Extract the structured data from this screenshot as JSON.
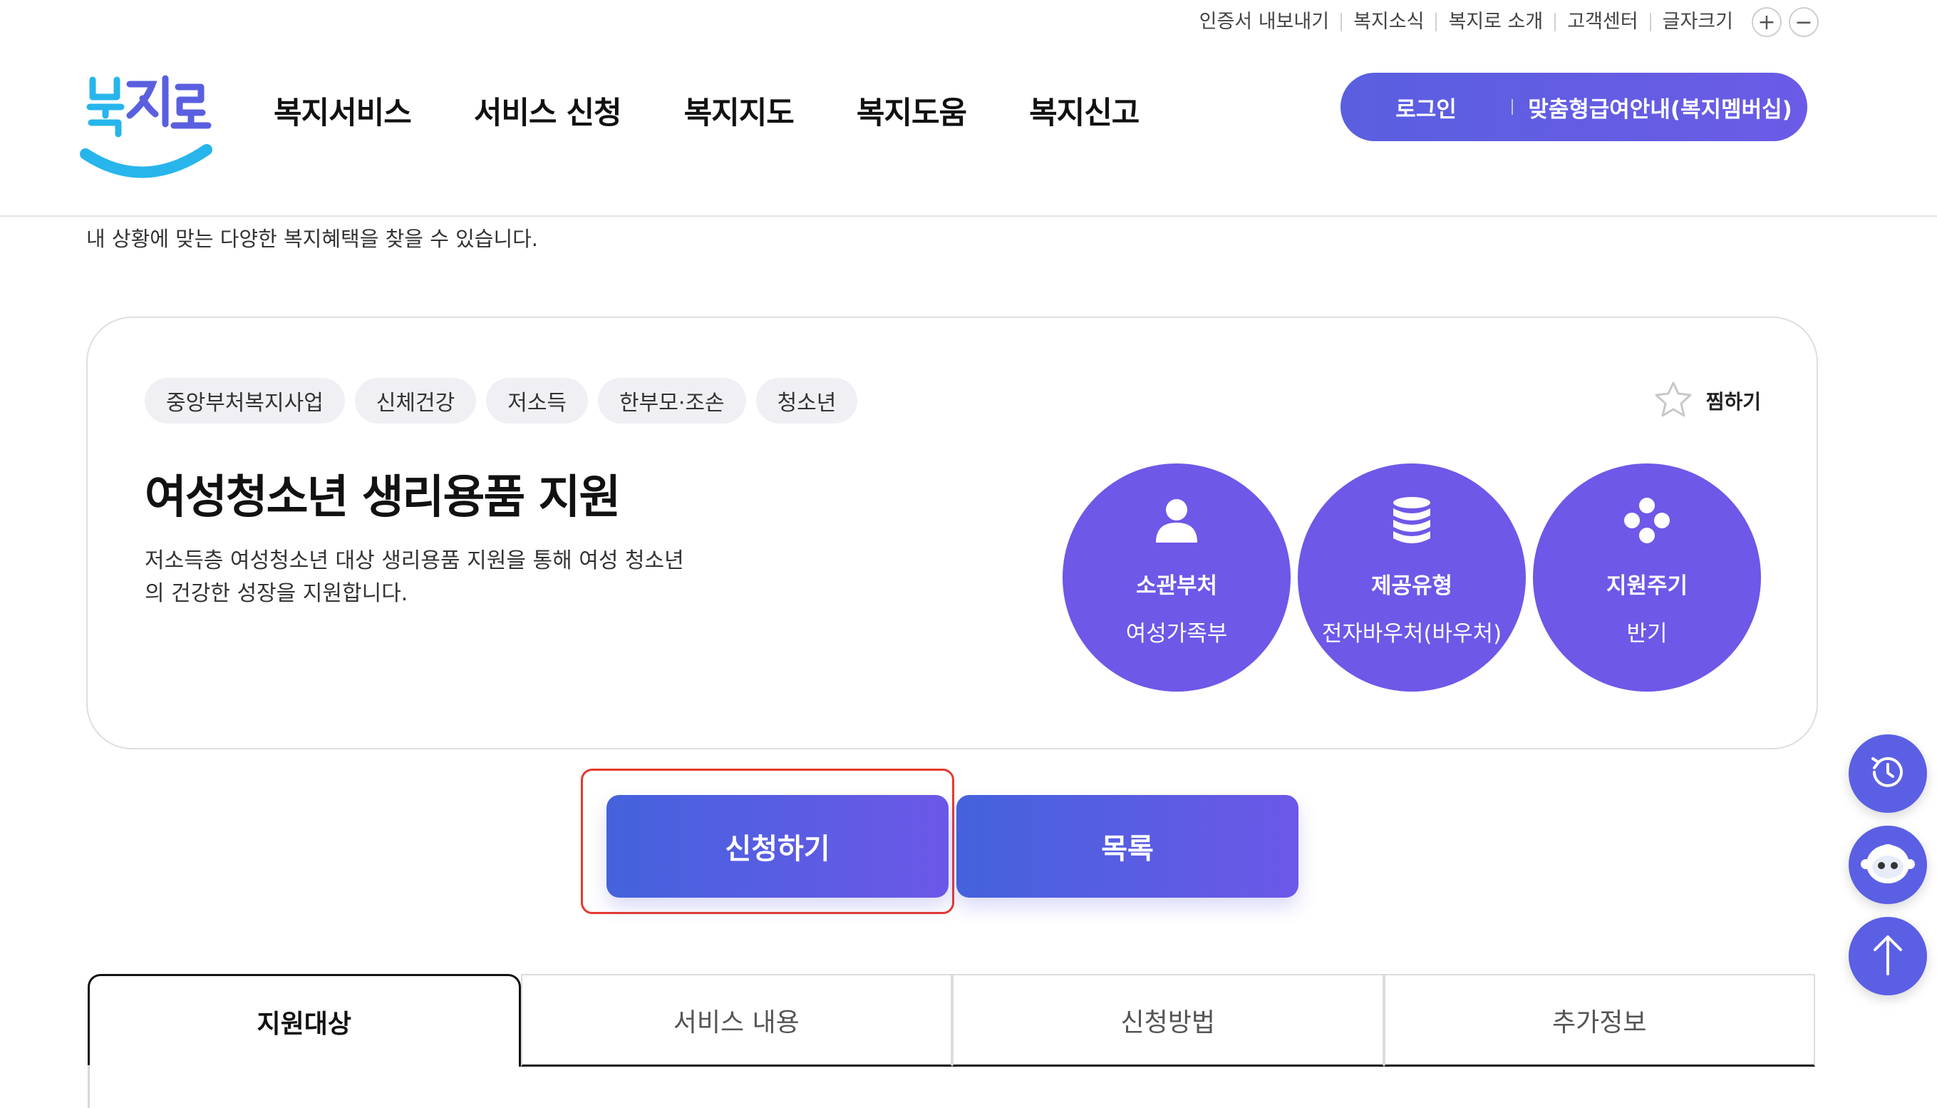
{
  "utility": {
    "links": [
      "인증서 내보내기",
      "복지소식",
      "복지로 소개",
      "고객센터"
    ],
    "font_size_label": "글자크기",
    "plus": "+",
    "minus": "−"
  },
  "logo": {
    "alt": "복지로"
  },
  "gnb": [
    "복지서비스",
    "서비스 신청",
    "복지지도",
    "복지도움",
    "복지신고"
  ],
  "account": {
    "login": "로그인",
    "membership": "맞춤형급여안내(복지멤버십)"
  },
  "page": {
    "subtitle": "내 상황에 맞는 다양한 복지혜택을 찾을 수 있습니다."
  },
  "service": {
    "tags": [
      "중앙부처복지사업",
      "신체건강",
      "저소득",
      "한부모·조손",
      "청소년"
    ],
    "favorite_label": "찜하기",
    "title": "여성청소년 생리용품 지원",
    "description": "저소득층 여성청소년 대상 생리용품 지원을 통해 여성 청소년의 건강한 성장을 지원합니다.",
    "info": [
      {
        "label": "소관부처",
        "value": "여성가족부",
        "icon": "person-icon"
      },
      {
        "label": "제공유형",
        "value": "전자바우처(바우처)",
        "icon": "database-icon"
      },
      {
        "label": "지원주기",
        "value": "반기",
        "icon": "diamond-dots-icon"
      }
    ]
  },
  "actions": {
    "apply": "신청하기",
    "list": "목록"
  },
  "tabs": [
    "지원대상",
    "서비스 내용",
    "신청방법",
    "추가정보"
  ],
  "colors": {
    "brand": "#6d58e8",
    "button_start": "#4462dc",
    "highlight": "#e53a2f"
  }
}
